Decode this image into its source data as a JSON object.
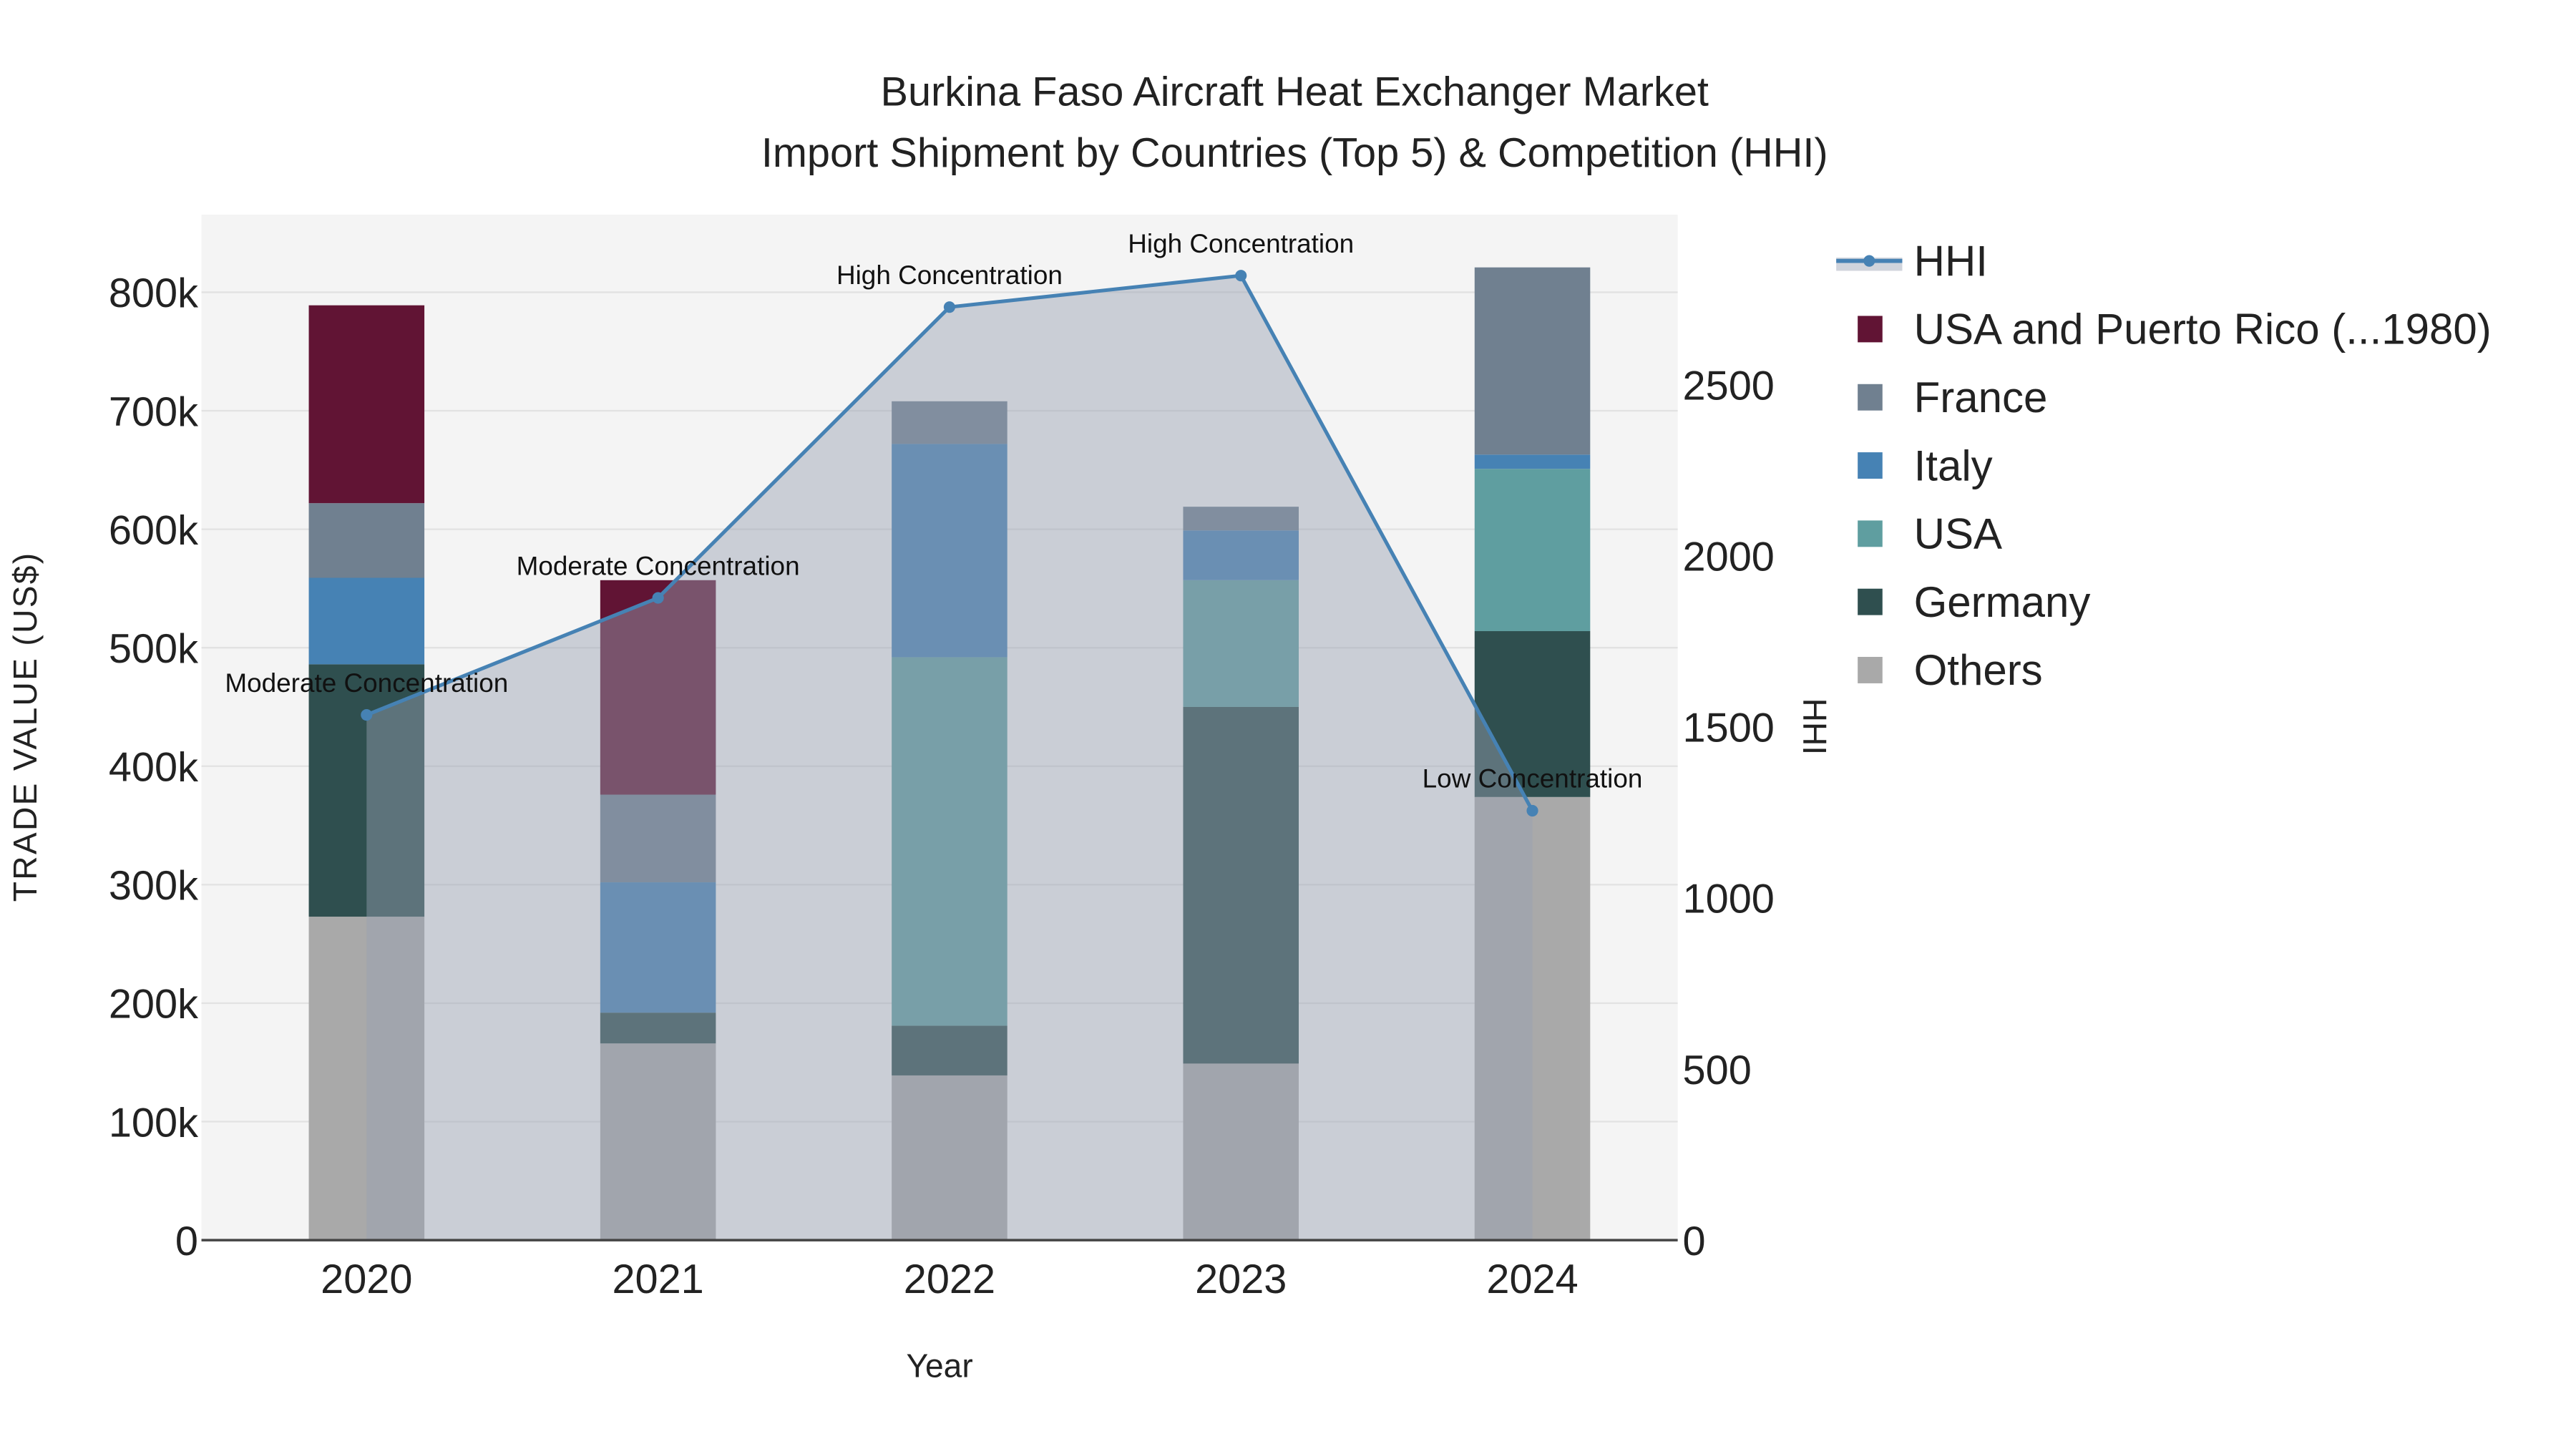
{
  "chart_data": {
    "type": "bar",
    "title_line1": "Burkina Faso Aircraft Heat Exchanger Market",
    "title_line2": "Import Shipment by Countries (Top 5) & Competition (HHI)",
    "xlabel": "Year",
    "ylabel": "TRADE VALUE (US$)",
    "y2label": "HHI",
    "ylim": [
      0,
      865000
    ],
    "y2lim": [
      0,
      3000
    ],
    "yticks": [
      0,
      100000,
      200000,
      300000,
      400000,
      500000,
      600000,
      700000,
      800000
    ],
    "ytick_labels": [
      "0",
      "100k",
      "200k",
      "300k",
      "400k",
      "500k",
      "600k",
      "700k",
      "800k"
    ],
    "y2ticks": [
      0,
      500,
      1000,
      1500,
      2000,
      2500
    ],
    "y2tick_labels": [
      "0",
      "500",
      "1000",
      "1500",
      "2000",
      "2500"
    ],
    "categories": [
      "2020",
      "2021",
      "2022",
      "2023",
      "2024"
    ],
    "series": [
      {
        "name": "Others",
        "color": "#a9a9a9",
        "values": [
          273000,
          166000,
          139000,
          149000,
          374000
        ]
      },
      {
        "name": "Germany",
        "color": "#2f4f4f",
        "values": [
          213000,
          26000,
          42000,
          301000,
          140000
        ]
      },
      {
        "name": "USA",
        "color": "#5f9ea0",
        "values": [
          0,
          0,
          311000,
          107000,
          137000
        ]
      },
      {
        "name": "Italy",
        "color": "#4682b4",
        "values": [
          73000,
          110000,
          180000,
          42000,
          12000
        ]
      },
      {
        "name": "France",
        "color": "#708090",
        "values": [
          63000,
          74000,
          36000,
          20000,
          158000
        ]
      },
      {
        "name": "USA and Puerto Rico (...1980)",
        "color": "#611434",
        "values": [
          167000,
          181000,
          0,
          0,
          0
        ]
      }
    ],
    "hhi": {
      "name": "HHI",
      "color": "#4682b4",
      "values": [
        1535,
        1877,
        2727,
        2819,
        1255
      ],
      "annotations": [
        "Moderate Concentration",
        "Moderate Concentration",
        "High Concentration",
        "High Concentration",
        "Low Concentration"
      ]
    },
    "legend_order": [
      "HHI",
      "USA and Puerto Rico (...1980)",
      "France",
      "Italy",
      "USA",
      "Germany",
      "Others"
    ],
    "legend_position": "right",
    "grid": true
  }
}
